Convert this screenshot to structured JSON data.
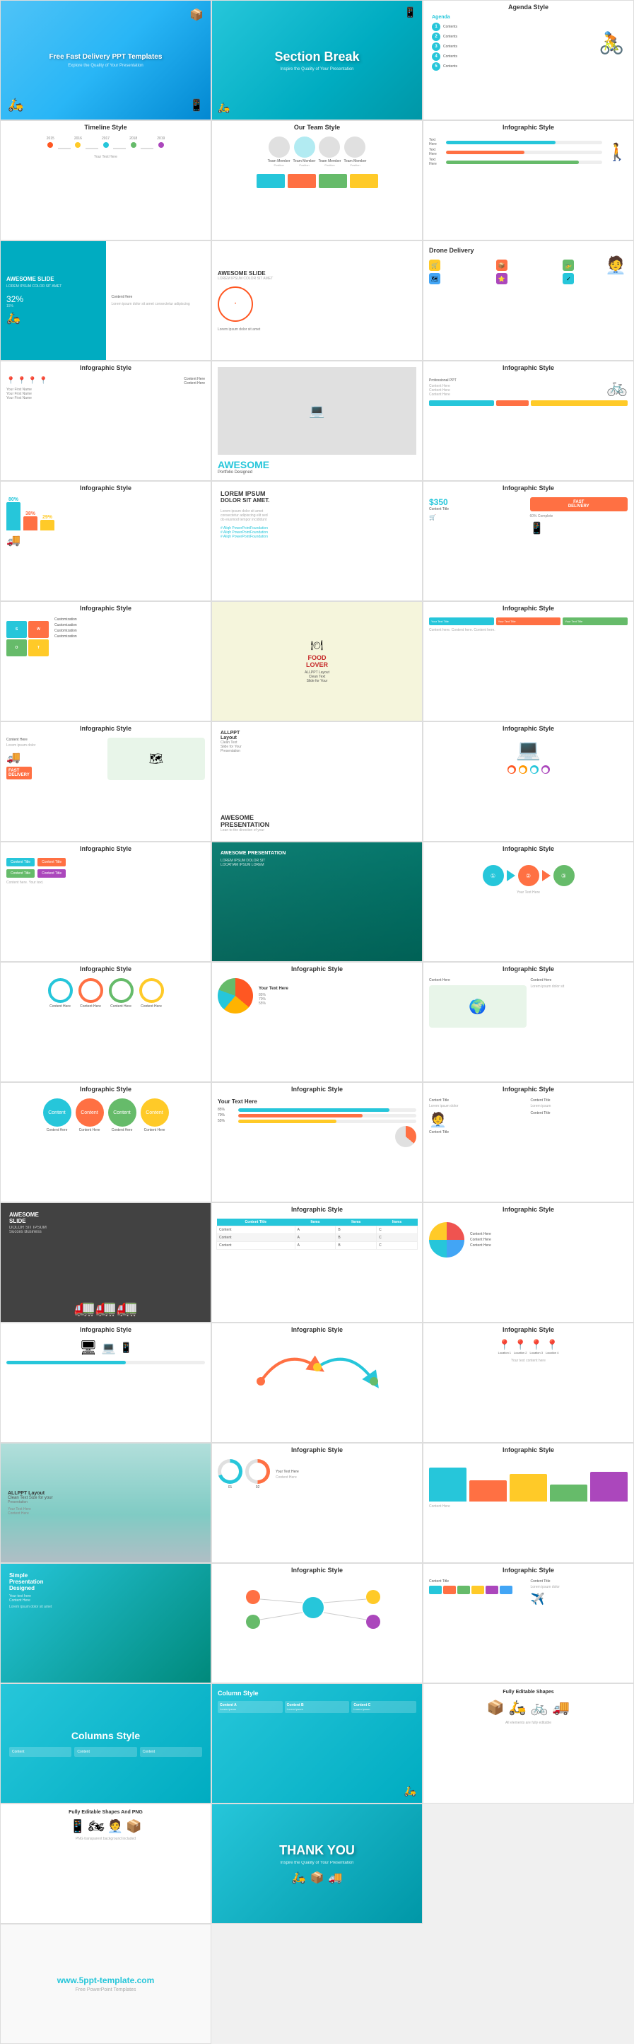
{
  "page": {
    "title": "Fast Delivery PPT Templates",
    "footer": "www.5ppt-template.com",
    "bg_color": "#f0f0f0"
  },
  "slides": [
    {
      "id": 1,
      "label": "",
      "type": "hero",
      "title": "Free Fast Delivery PPT Templates",
      "bg": "blue-grad"
    },
    {
      "id": 2,
      "label": "Section Break",
      "type": "section-break",
      "subtitle": "Inspire the Quality of Your Presentation",
      "bg": "teal"
    },
    {
      "id": 3,
      "label": "",
      "type": "agenda",
      "title": "Agenda Style",
      "bg": "white"
    },
    {
      "id": 4,
      "label": "Timeline Style",
      "type": "timeline",
      "bg": "white"
    },
    {
      "id": 5,
      "label": "Our Team Style",
      "type": "team",
      "bg": "white"
    },
    {
      "id": 6,
      "label": "Infographic Style",
      "type": "infographic",
      "bg": "white"
    },
    {
      "id": 7,
      "label": "",
      "type": "awesome",
      "title": "AWESOME SLIDE",
      "bg": "white"
    },
    {
      "id": 8,
      "label": "",
      "type": "awesome2",
      "title": "AWESOME SLIDE",
      "bg": "white"
    },
    {
      "id": 9,
      "label": "",
      "type": "drone",
      "title": "Drone Delivery",
      "bg": "white"
    },
    {
      "id": 10,
      "label": "Infographic Style",
      "type": "infographic-map",
      "bg": "white"
    },
    {
      "id": 11,
      "label": "",
      "type": "awesome3",
      "title": "AWESOME",
      "bg": "white"
    },
    {
      "id": 12,
      "label": "Infographic Style",
      "type": "infographic-bike",
      "bg": "white"
    },
    {
      "id": 13,
      "label": "Infographic Style",
      "type": "infographic-stats",
      "bg": "white"
    },
    {
      "id": 14,
      "label": "",
      "type": "lorem",
      "title": "LOREM IPSUM DOLOR SIT AMET",
      "bg": "white"
    },
    {
      "id": 15,
      "label": "Infographic Style",
      "type": "infographic-fast",
      "bg": "white"
    },
    {
      "id": 16,
      "label": "Infographic Style",
      "type": "swot",
      "bg": "white"
    },
    {
      "id": 17,
      "label": "",
      "type": "food",
      "title": "FOOD LOVER",
      "bg": "white"
    },
    {
      "id": 18,
      "label": "Infographic Style",
      "type": "infographic-right",
      "bg": "white"
    },
    {
      "id": 19,
      "label": "Infographic Style",
      "type": "infographic-delivery",
      "bg": "white"
    },
    {
      "id": 20,
      "label": "",
      "type": "awesome4",
      "title": "AWESOME PRESENTATION",
      "bg": "white"
    },
    {
      "id": 21,
      "label": "Infographic Style",
      "type": "infographic-laptop",
      "bg": "white"
    },
    {
      "id": 22,
      "label": "Infographic Style",
      "type": "infographic-pres",
      "bg": "white"
    },
    {
      "id": 23,
      "label": "",
      "type": "awesome5",
      "title": "AWESOME PRESENTATION",
      "bg": "green-teal"
    },
    {
      "id": 24,
      "label": "Infographic Style",
      "type": "infographic-arrows",
      "bg": "white"
    },
    {
      "id": 25,
      "label": "Infographic Style",
      "type": "infographic-circles",
      "bg": "white"
    },
    {
      "id": 26,
      "label": "Infographic Style",
      "type": "infographic-pie",
      "bg": "white"
    },
    {
      "id": 27,
      "label": "Infographic Style",
      "type": "infographic-brazil",
      "bg": "white"
    },
    {
      "id": 28,
      "label": "Infographic Style",
      "type": "infographic-3circles",
      "bg": "white"
    },
    {
      "id": 29,
      "label": "Infographic Style",
      "type": "infographic-progress",
      "bg": "white"
    },
    {
      "id": 30,
      "label": "Infographic Style",
      "type": "infographic-delivery2",
      "bg": "white"
    },
    {
      "id": 31,
      "label": "",
      "type": "awesome6",
      "title": "AWESOME SLIDE",
      "bg": "dark"
    },
    {
      "id": 32,
      "label": "Infographic Style",
      "type": "infographic-table",
      "bg": "white"
    },
    {
      "id": 33,
      "label": "Infographic Style",
      "type": "infographic-compass",
      "bg": "white"
    },
    {
      "id": 34,
      "label": "Infographic Style",
      "type": "infographic-screens",
      "bg": "white"
    },
    {
      "id": 35,
      "label": "Infographic Style",
      "type": "infographic-curved",
      "bg": "white"
    },
    {
      "id": 36,
      "label": "Infographic Style",
      "type": "infographic-pins",
      "bg": "white"
    },
    {
      "id": 37,
      "label": "",
      "type": "road",
      "title": "ALLPPT Layout Clean Text",
      "bg": "light"
    },
    {
      "id": 38,
      "label": "Infographic Style",
      "type": "infographic-donut",
      "bg": "white"
    },
    {
      "id": 39,
      "label": "Infographic Style",
      "type": "infographic-bars",
      "bg": "white"
    },
    {
      "id": 40,
      "label": "",
      "type": "simple",
      "title": "Simple Presentation Designed",
      "bg": "teal2"
    },
    {
      "id": 41,
      "label": "Infographic Style",
      "type": "infographic-nodes",
      "bg": "white"
    },
    {
      "id": 42,
      "label": "Infographic Style",
      "type": "infographic-last",
      "bg": "white"
    },
    {
      "id": 43,
      "label": "",
      "type": "columns-style",
      "title": "Columns Style",
      "bg": "teal"
    },
    {
      "id": 44,
      "label": "",
      "type": "column-style",
      "title": "Column Style",
      "bg": "teal"
    },
    {
      "id": 45,
      "label": "",
      "type": "fully-editable",
      "title": "Fully Editable Shapes",
      "bg": "white"
    },
    {
      "id": 46,
      "label": "",
      "type": "fully-editable-png",
      "title": "Fully Editable Shapes And PNG",
      "bg": "white"
    },
    {
      "id": 47,
      "label": "THANK YOU",
      "type": "thank-you",
      "title": "THANK YOU",
      "bg": "teal"
    },
    {
      "id": 48,
      "label": "",
      "type": "website",
      "title": "www.5ppt-template.com",
      "bg": "white"
    }
  ],
  "colors": {
    "teal": "#26c6da",
    "teal_dark": "#00acc1",
    "orange": "#ff7043",
    "yellow": "#ffca28",
    "green": "#66bb6a",
    "red": "#ef5350",
    "blue": "#42a5f5",
    "purple": "#ab47bc",
    "pink": "#ec407a",
    "grey": "#90a4ae"
  }
}
